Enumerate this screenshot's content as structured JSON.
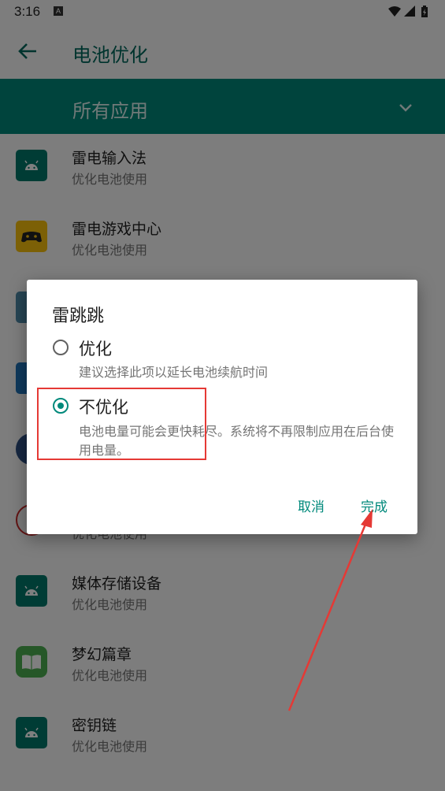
{
  "status": {
    "time": "3:16",
    "notif_badge": "A"
  },
  "appbar": {
    "title": "电池优化",
    "back_icon": "arrow-back-icon"
  },
  "filter": {
    "label": "所有应用",
    "dropdown_icon": "chevron-down-icon"
  },
  "apps": [
    {
      "name": "雷电输入法",
      "sub": "优化电池使用",
      "icon": "android-icon"
    },
    {
      "name": "雷电游戏中心",
      "sub": "优化电池使用",
      "icon": "gamepad-icon"
    },
    {
      "name": "",
      "sub": "优化电池使用",
      "icon": "app-icon"
    },
    {
      "name": "媒体存储设备",
      "sub": "优化电池使用",
      "icon": "android-icon"
    },
    {
      "name": "梦幻篇章",
      "sub": "优化电池使用",
      "icon": "book-icon"
    },
    {
      "name": "密钥链",
      "sub": "优化电池使用",
      "icon": "android-icon"
    }
  ],
  "dialog": {
    "title": "雷跳跳",
    "options": [
      {
        "label": "优化",
        "desc": "建议选择此项以延长电池续航时间",
        "selected": false
      },
      {
        "label": "不优化",
        "desc": "电池电量可能会更快耗尽。系统将不再限制应用在后台使用电量。",
        "selected": true
      }
    ],
    "cancel": "取消",
    "done": "完成"
  },
  "colors": {
    "accent": "#00897b",
    "annotation": "#e53935"
  }
}
